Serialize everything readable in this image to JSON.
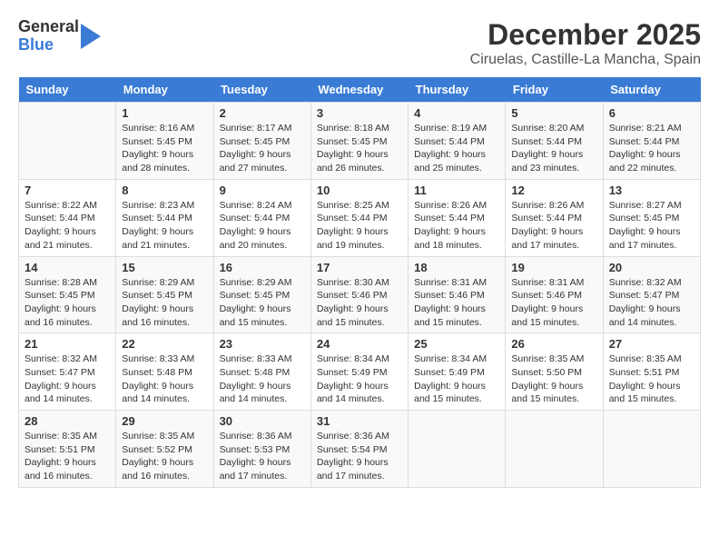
{
  "logo": {
    "line1": "General",
    "line2": "Blue"
  },
  "title": "December 2025",
  "subtitle": "Ciruelas, Castille-La Mancha, Spain",
  "days_of_week": [
    "Sunday",
    "Monday",
    "Tuesday",
    "Wednesday",
    "Thursday",
    "Friday",
    "Saturday"
  ],
  "weeks": [
    [
      {
        "day": "",
        "info": ""
      },
      {
        "day": "1",
        "info": "Sunrise: 8:16 AM\nSunset: 5:45 PM\nDaylight: 9 hours\nand 28 minutes."
      },
      {
        "day": "2",
        "info": "Sunrise: 8:17 AM\nSunset: 5:45 PM\nDaylight: 9 hours\nand 27 minutes."
      },
      {
        "day": "3",
        "info": "Sunrise: 8:18 AM\nSunset: 5:45 PM\nDaylight: 9 hours\nand 26 minutes."
      },
      {
        "day": "4",
        "info": "Sunrise: 8:19 AM\nSunset: 5:44 PM\nDaylight: 9 hours\nand 25 minutes."
      },
      {
        "day": "5",
        "info": "Sunrise: 8:20 AM\nSunset: 5:44 PM\nDaylight: 9 hours\nand 23 minutes."
      },
      {
        "day": "6",
        "info": "Sunrise: 8:21 AM\nSunset: 5:44 PM\nDaylight: 9 hours\nand 22 minutes."
      }
    ],
    [
      {
        "day": "7",
        "info": "Sunrise: 8:22 AM\nSunset: 5:44 PM\nDaylight: 9 hours\nand 21 minutes."
      },
      {
        "day": "8",
        "info": "Sunrise: 8:23 AM\nSunset: 5:44 PM\nDaylight: 9 hours\nand 21 minutes."
      },
      {
        "day": "9",
        "info": "Sunrise: 8:24 AM\nSunset: 5:44 PM\nDaylight: 9 hours\nand 20 minutes."
      },
      {
        "day": "10",
        "info": "Sunrise: 8:25 AM\nSunset: 5:44 PM\nDaylight: 9 hours\nand 19 minutes."
      },
      {
        "day": "11",
        "info": "Sunrise: 8:26 AM\nSunset: 5:44 PM\nDaylight: 9 hours\nand 18 minutes."
      },
      {
        "day": "12",
        "info": "Sunrise: 8:26 AM\nSunset: 5:44 PM\nDaylight: 9 hours\nand 17 minutes."
      },
      {
        "day": "13",
        "info": "Sunrise: 8:27 AM\nSunset: 5:45 PM\nDaylight: 9 hours\nand 17 minutes."
      }
    ],
    [
      {
        "day": "14",
        "info": "Sunrise: 8:28 AM\nSunset: 5:45 PM\nDaylight: 9 hours\nand 16 minutes."
      },
      {
        "day": "15",
        "info": "Sunrise: 8:29 AM\nSunset: 5:45 PM\nDaylight: 9 hours\nand 16 minutes."
      },
      {
        "day": "16",
        "info": "Sunrise: 8:29 AM\nSunset: 5:45 PM\nDaylight: 9 hours\nand 15 minutes."
      },
      {
        "day": "17",
        "info": "Sunrise: 8:30 AM\nSunset: 5:46 PM\nDaylight: 9 hours\nand 15 minutes."
      },
      {
        "day": "18",
        "info": "Sunrise: 8:31 AM\nSunset: 5:46 PM\nDaylight: 9 hours\nand 15 minutes."
      },
      {
        "day": "19",
        "info": "Sunrise: 8:31 AM\nSunset: 5:46 PM\nDaylight: 9 hours\nand 15 minutes."
      },
      {
        "day": "20",
        "info": "Sunrise: 8:32 AM\nSunset: 5:47 PM\nDaylight: 9 hours\nand 14 minutes."
      }
    ],
    [
      {
        "day": "21",
        "info": "Sunrise: 8:32 AM\nSunset: 5:47 PM\nDaylight: 9 hours\nand 14 minutes."
      },
      {
        "day": "22",
        "info": "Sunrise: 8:33 AM\nSunset: 5:48 PM\nDaylight: 9 hours\nand 14 minutes."
      },
      {
        "day": "23",
        "info": "Sunrise: 8:33 AM\nSunset: 5:48 PM\nDaylight: 9 hours\nand 14 minutes."
      },
      {
        "day": "24",
        "info": "Sunrise: 8:34 AM\nSunset: 5:49 PM\nDaylight: 9 hours\nand 14 minutes."
      },
      {
        "day": "25",
        "info": "Sunrise: 8:34 AM\nSunset: 5:49 PM\nDaylight: 9 hours\nand 15 minutes."
      },
      {
        "day": "26",
        "info": "Sunrise: 8:35 AM\nSunset: 5:50 PM\nDaylight: 9 hours\nand 15 minutes."
      },
      {
        "day": "27",
        "info": "Sunrise: 8:35 AM\nSunset: 5:51 PM\nDaylight: 9 hours\nand 15 minutes."
      }
    ],
    [
      {
        "day": "28",
        "info": "Sunrise: 8:35 AM\nSunset: 5:51 PM\nDaylight: 9 hours\nand 16 minutes."
      },
      {
        "day": "29",
        "info": "Sunrise: 8:35 AM\nSunset: 5:52 PM\nDaylight: 9 hours\nand 16 minutes."
      },
      {
        "day": "30",
        "info": "Sunrise: 8:36 AM\nSunset: 5:53 PM\nDaylight: 9 hours\nand 17 minutes."
      },
      {
        "day": "31",
        "info": "Sunrise: 8:36 AM\nSunset: 5:54 PM\nDaylight: 9 hours\nand 17 minutes."
      },
      {
        "day": "",
        "info": ""
      },
      {
        "day": "",
        "info": ""
      },
      {
        "day": "",
        "info": ""
      }
    ]
  ]
}
